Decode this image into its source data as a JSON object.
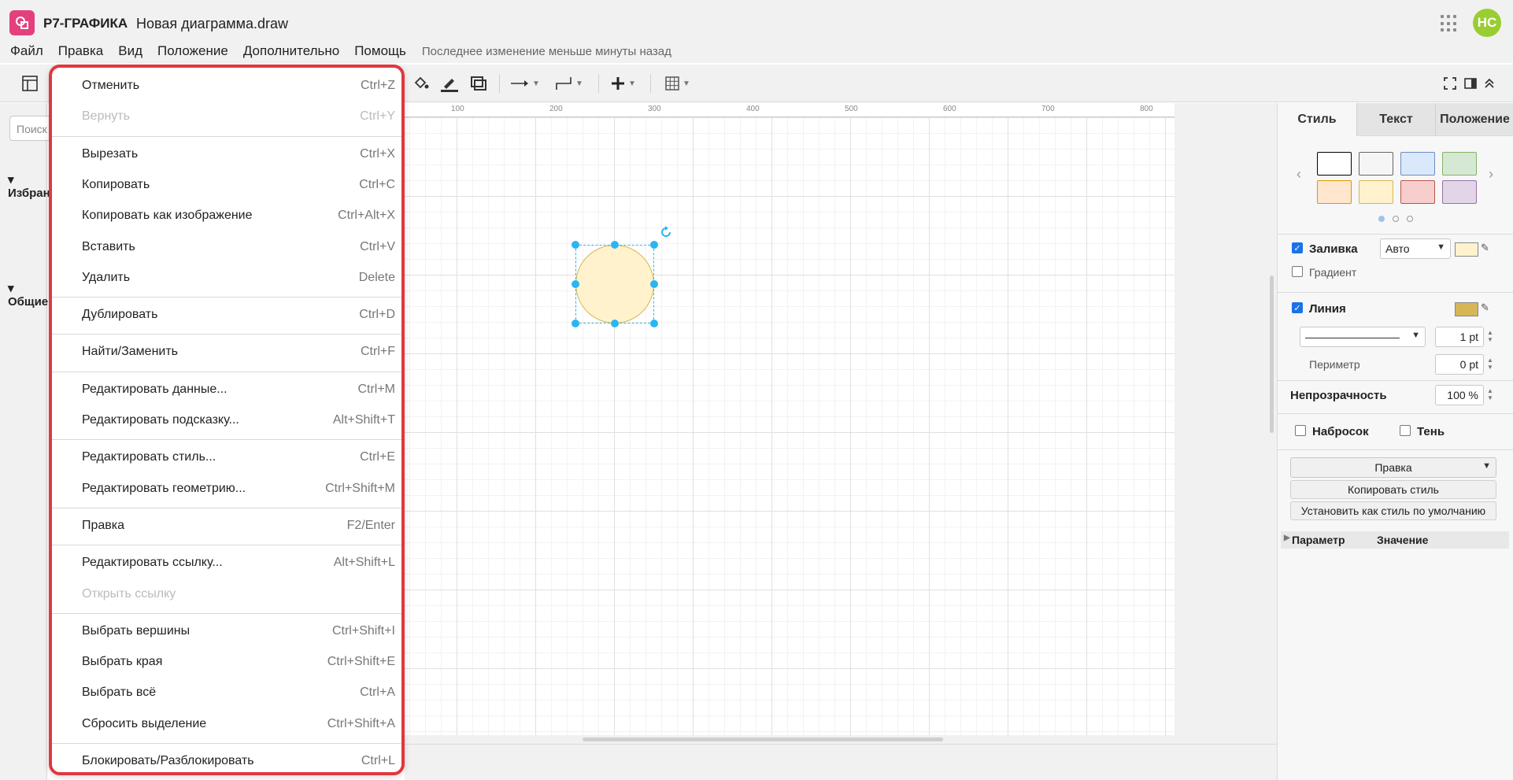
{
  "app": {
    "name": "Р7-ГРАФИКА",
    "document": "Новая диаграмма.draw",
    "avatar_initials": "НС",
    "brand_color": "#e3407e",
    "avatar_color": "#9acd32"
  },
  "menubar": {
    "items": [
      "Файл",
      "Правка",
      "Вид",
      "Положение",
      "Дополнительно",
      "Помощь"
    ],
    "last_change": "Последнее изменение меньше минуты назад"
  },
  "toolbar": {
    "icons": [
      "layout-icon",
      "fill-color-icon",
      "line-color-icon",
      "shadow-icon",
      "connection-icon",
      "waypoint-icon",
      "insert-icon",
      "table-icon",
      "fullscreen-icon",
      "format-panel-icon",
      "collapse-icon"
    ]
  },
  "sidebar": {
    "search_placeholder": "Поиск",
    "sections": [
      "Избранное",
      "Общие"
    ]
  },
  "ruler": {
    "ticks": [
      "100",
      "200",
      "300",
      "400",
      "500",
      "600",
      "700",
      "800"
    ]
  },
  "shape": {
    "fill": "#fff2cc",
    "stroke": "#d6b656",
    "selection_color": "#29b6f2"
  },
  "edit_menu": {
    "border_color": "#e0383e",
    "groups": [
      [
        {
          "label": "Отменить",
          "shortcut": "Ctrl+Z",
          "enabled": true
        },
        {
          "label": "Вернуть",
          "shortcut": "Ctrl+Y",
          "enabled": false
        }
      ],
      [
        {
          "label": "Вырезать",
          "shortcut": "Ctrl+X",
          "enabled": true
        },
        {
          "label": "Копировать",
          "shortcut": "Ctrl+C",
          "enabled": true
        },
        {
          "label": "Копировать как изображение",
          "shortcut": "Ctrl+Alt+X",
          "enabled": true
        },
        {
          "label": "Вставить",
          "shortcut": "Ctrl+V",
          "enabled": true
        },
        {
          "label": "Удалить",
          "shortcut": "Delete",
          "enabled": true
        }
      ],
      [
        {
          "label": "Дублировать",
          "shortcut": "Ctrl+D",
          "enabled": true
        }
      ],
      [
        {
          "label": "Найти/Заменить",
          "shortcut": "Ctrl+F",
          "enabled": true
        }
      ],
      [
        {
          "label": "Редактировать данные...",
          "shortcut": "Ctrl+M",
          "enabled": true
        },
        {
          "label": "Редактировать подсказку...",
          "shortcut": "Alt+Shift+T",
          "enabled": true
        }
      ],
      [
        {
          "label": "Редактировать стиль...",
          "shortcut": "Ctrl+E",
          "enabled": true
        },
        {
          "label": "Редактировать геометрию...",
          "shortcut": "Ctrl+Shift+M",
          "enabled": true
        }
      ],
      [
        {
          "label": "Правка",
          "shortcut": "F2/Enter",
          "enabled": true
        }
      ],
      [
        {
          "label": "Редактировать ссылку...",
          "shortcut": "Alt+Shift+L",
          "enabled": true
        },
        {
          "label": "Открыть ссылку",
          "shortcut": "",
          "enabled": false
        }
      ],
      [
        {
          "label": "Выбрать вершины",
          "shortcut": "Ctrl+Shift+I",
          "enabled": true
        },
        {
          "label": "Выбрать края",
          "shortcut": "Ctrl+Shift+E",
          "enabled": true
        },
        {
          "label": "Выбрать всё",
          "shortcut": "Ctrl+A",
          "enabled": true
        },
        {
          "label": "Сбросить выделение",
          "shortcut": "Ctrl+Shift+A",
          "enabled": true
        }
      ],
      [
        {
          "label": "Блокировать/Разблокировать",
          "shortcut": "Ctrl+L",
          "enabled": true
        }
      ]
    ]
  },
  "format_panel": {
    "tabs": [
      "Стиль",
      "Текст",
      "Положение"
    ],
    "swatches": [
      {
        "fill": "#ffffff",
        "stroke": "#000000"
      },
      {
        "fill": "#f5f5f5",
        "stroke": "#666666"
      },
      {
        "fill": "#dae8fc",
        "stroke": "#6c8ebf"
      },
      {
        "fill": "#d5e8d4",
        "stroke": "#82b366"
      },
      {
        "fill": "#ffe6cc",
        "stroke": "#d79b00"
      },
      {
        "fill": "#fff2cc",
        "stroke": "#d6b656"
      },
      {
        "fill": "#f8cecc",
        "stroke": "#b85450"
      },
      {
        "fill": "#e1d5e7",
        "stroke": "#9673a6"
      }
    ],
    "fill": {
      "label": "Заливка",
      "checked": true,
      "mode": "Авто",
      "color": "#fff2cc"
    },
    "gradient": {
      "label": "Градиент",
      "checked": false
    },
    "line": {
      "label": "Линия",
      "checked": true,
      "color": "#d6b656",
      "width": "1 pt"
    },
    "perimeter": {
      "label": "Периметр",
      "value": "0 pt"
    },
    "opacity": {
      "label": "Непрозрачность",
      "value": "100 %"
    },
    "sketch": {
      "label": "Набросок",
      "checked": false
    },
    "shadow": {
      "label": "Тень",
      "checked": false
    },
    "edit_select": "Правка",
    "copy_style": "Копировать стиль",
    "set_default": "Установить как стиль по умолчанию",
    "prop_columns": [
      "Параметр",
      "Значение"
    ]
  }
}
